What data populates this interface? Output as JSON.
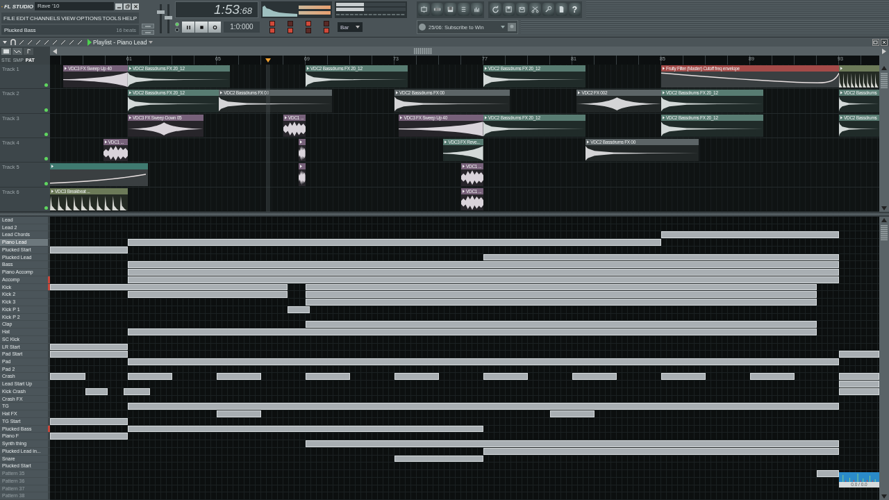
{
  "app": {
    "logo": "FL STUDIO",
    "title": "Rave '10"
  },
  "menu": [
    "FILE",
    "EDIT",
    "CHANNELS",
    "VIEW",
    "OPTIONS",
    "TOOLS",
    "HELP"
  ],
  "hint": {
    "text": "Plucked Bass",
    "detail": "16 beats"
  },
  "transport": {
    "time": "1:53",
    "time_fraction": ":68",
    "song_position": "1:0:000",
    "snap": "Bar"
  },
  "sliders": [
    {
      "level": 0.75
    },
    {
      "level": 0.55
    }
  ],
  "modes": [
    {
      "selected": true
    },
    {
      "selected": false
    }
  ],
  "toggles": [
    {
      "on": true
    },
    {
      "on": false
    },
    {
      "on": true
    },
    {
      "on": false
    },
    {
      "on": true
    },
    {
      "on": true
    },
    {
      "on": false
    },
    {
      "on": true
    }
  ],
  "news": "25/06: Subscribe to Win",
  "help": "?",
  "playlist": {
    "title": "Playlist - Piano Lead",
    "filters": [
      {
        "label": "STE",
        "selected": false
      },
      {
        "label": "SMP",
        "selected": false
      },
      {
        "label": "PAT",
        "selected": true
      }
    ],
    "ruler": [
      "61",
      "65",
      "69",
      "73",
      "77",
      "81",
      "85",
      "89",
      "93"
    ],
    "tracks": [
      {
        "name": "Track 1",
        "active": true,
        "clips": [
          {
            "kind": "audio",
            "color": "#77617a",
            "name": "VDC3 FX Sweep Up 40"
          },
          {
            "kind": "audio",
            "color": "#587c72",
            "name": "VDC2 Bassdrums FX 20_12"
          },
          {
            "kind": "audio",
            "color": "#587c72",
            "name": "VDC2 Bassdrums FX 20_12"
          },
          {
            "kind": "audio",
            "color": "#587c72",
            "name": "VDC2 Bassdrums FX 20_12"
          },
          {
            "kind": "automation",
            "color": "#a44a48",
            "name": "Fruity Filter (Master)   Cutoff freq envelope"
          },
          {
            "kind": "beat",
            "color": "#6c7a58"
          }
        ]
      },
      {
        "name": "Track 2",
        "active": true,
        "clips": [
          {
            "kind": "audio",
            "color": "#587c72",
            "name": "VDC2 Bassdrums FX 20_12"
          },
          {
            "kind": "audio",
            "color": "#5c6466",
            "name": "VDC2 Bassdrums FX 00"
          },
          {
            "kind": "audio",
            "color": "#5c6466",
            "name": "VDC2 Bassdrums FX 00"
          },
          {
            "kind": "audio",
            "color": "#5c6466",
            "name": "VDC2 FX 002"
          },
          {
            "kind": "audio",
            "color": "#587c72",
            "name": "VDC2 Bassdrums FX 20_12"
          },
          {
            "kind": "audio",
            "color": "#587c72",
            "name": "VDC2 Bassdrums"
          }
        ]
      },
      {
        "name": "Track 3",
        "active": true,
        "clips": [
          {
            "kind": "audio",
            "color": "#77617a",
            "name": "VDC3 FX Sweep Down 05"
          },
          {
            "kind": "audio",
            "color": "#77617a",
            "name": "VDC1 ..."
          },
          {
            "kind": "audio",
            "color": "#77617a",
            "name": "VDC3 FX Sweep Up 40"
          },
          {
            "kind": "audio",
            "color": "#587c72",
            "name": "VDC2 Bassdrums FX 20_12"
          },
          {
            "kind": "audio",
            "color": "#587c72",
            "name": "VDC2 Bassdrums FX 20_12"
          },
          {
            "kind": "audio",
            "color": "#587c72",
            "name": "VDC2 Bassdrums"
          }
        ]
      },
      {
        "name": "Track 4",
        "active": true,
        "clips": [
          {
            "kind": "audio",
            "color": "#77617a",
            "name": "VDC1 ..."
          },
          {
            "kind": "audio",
            "color": "#77617a"
          },
          {
            "kind": "audio",
            "color": "#587c72",
            "name": "VDC3 FX Reve..."
          },
          {
            "kind": "audio",
            "color": "#5c6466",
            "name": "VDC2 Bassdrums FX 00"
          }
        ]
      },
      {
        "name": "Track 5",
        "active": true,
        "clips": [
          {
            "kind": "automation",
            "color": "#3f7a70"
          },
          {
            "kind": "audio",
            "color": "#77617a"
          },
          {
            "kind": "audio",
            "color": "#77617a",
            "name": "VDC1 ..."
          }
        ]
      },
      {
        "name": "Track 6",
        "active": true,
        "clips": [
          {
            "kind": "beat",
            "color": "#6c7a58",
            "name": "VDC3 Breakbeat ..."
          },
          {
            "kind": "audio",
            "color": "#77617a",
            "name": "VDC1 ..."
          }
        ]
      }
    ]
  },
  "patterns": [
    {
      "name": "Lead",
      "selected": false,
      "marked": false,
      "empty": false
    },
    {
      "name": "Lead 2",
      "selected": false,
      "marked": false,
      "empty": false
    },
    {
      "name": "Lead Chords",
      "selected": false,
      "marked": false,
      "empty": false
    },
    {
      "name": "Piano Lead",
      "selected": true,
      "marked": false,
      "empty": false
    },
    {
      "name": "Plucked Start",
      "selected": false,
      "marked": false,
      "empty": false
    },
    {
      "name": "Plucked Lead",
      "selected": false,
      "marked": false,
      "empty": false
    },
    {
      "name": "Bass",
      "selected": false,
      "marked": false,
      "empty": false
    },
    {
      "name": "Piano Accomp",
      "selected": false,
      "marked": false,
      "empty": false
    },
    {
      "name": "Accomp",
      "selected": false,
      "marked": true,
      "empty": false
    },
    {
      "name": "Kick",
      "selected": false,
      "marked": true,
      "empty": false
    },
    {
      "name": "Kick 2",
      "selected": false,
      "marked": false,
      "empty": false
    },
    {
      "name": "Kick 3",
      "selected": false,
      "marked": false,
      "empty": false
    },
    {
      "name": "Kick P 1",
      "selected": false,
      "marked": false,
      "empty": false
    },
    {
      "name": "Kick P 2",
      "selected": false,
      "marked": false,
      "empty": false
    },
    {
      "name": "Clap",
      "selected": false,
      "marked": false,
      "empty": false
    },
    {
      "name": "Hat",
      "selected": false,
      "marked": false,
      "empty": false
    },
    {
      "name": "SC Kick",
      "selected": false,
      "marked": false,
      "empty": false
    },
    {
      "name": "LR Start",
      "selected": false,
      "marked": false,
      "empty": false
    },
    {
      "name": "Pad Start",
      "selected": false,
      "marked": false,
      "empty": false
    },
    {
      "name": "Pad",
      "selected": false,
      "marked": false,
      "empty": false
    },
    {
      "name": "Pad 2",
      "selected": false,
      "marked": false,
      "empty": false
    },
    {
      "name": "Crash",
      "selected": false,
      "marked": false,
      "empty": false
    },
    {
      "name": "Lead Start Up",
      "selected": false,
      "marked": false,
      "empty": false
    },
    {
      "name": "Kick Crash",
      "selected": false,
      "marked": false,
      "empty": false
    },
    {
      "name": "Crash FX",
      "selected": false,
      "marked": false,
      "empty": false
    },
    {
      "name": "TG",
      "selected": false,
      "marked": false,
      "empty": false
    },
    {
      "name": "Hat FX",
      "selected": false,
      "marked": false,
      "empty": false
    },
    {
      "name": "TG Start",
      "selected": false,
      "marked": false,
      "empty": false
    },
    {
      "name": "Plucked Bass",
      "selected": false,
      "marked": true,
      "empty": false
    },
    {
      "name": "Piano F",
      "selected": false,
      "marked": false,
      "empty": false
    },
    {
      "name": "Synth thing",
      "selected": false,
      "marked": false,
      "empty": false
    },
    {
      "name": "Plucked Lead in...",
      "selected": false,
      "marked": false,
      "empty": false
    },
    {
      "name": "Snare",
      "selected": false,
      "marked": false,
      "empty": false
    },
    {
      "name": "Plucked Start",
      "selected": false,
      "marked": false,
      "empty": false
    },
    {
      "name": "Pattern 35",
      "selected": false,
      "marked": false,
      "empty": true
    },
    {
      "name": "Pattern 36",
      "selected": false,
      "marked": false,
      "empty": true
    },
    {
      "name": "Pattern 37",
      "selected": false,
      "marked": false,
      "empty": true
    },
    {
      "name": "Pattern 38",
      "selected": false,
      "marked": false,
      "empty": true
    }
  ],
  "performance": "0.0 / 0.0"
}
